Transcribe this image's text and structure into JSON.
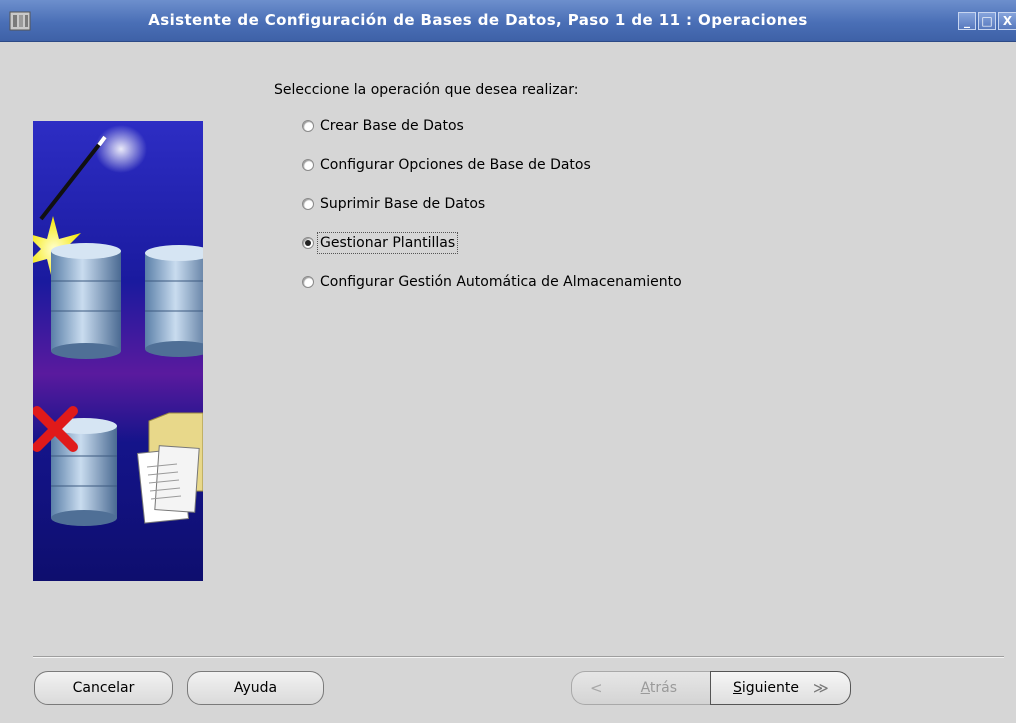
{
  "window": {
    "title": "Asistente de Configuración de Bases de Datos, Paso 1 de 11 : Operaciones",
    "minimize_glyph": "_",
    "maximize_glyph": "□",
    "close_glyph": "X"
  },
  "prompt": "Seleccione la operación que desea realizar:",
  "options": [
    {
      "label": "Crear Base de Datos",
      "checked": false
    },
    {
      "label": "Configurar Opciones de Base de Datos",
      "checked": false
    },
    {
      "label": "Suprimir Base de Datos",
      "checked": false
    },
    {
      "label": "Gestionar Plantillas",
      "checked": true
    },
    {
      "label": "Configurar Gestión Automática de Almacenamiento",
      "checked": false
    }
  ],
  "buttons": {
    "cancel": "Cancelar",
    "help": "Ayuda",
    "back": "Atrás",
    "back_arrow": "<",
    "next": "Siguiente",
    "next_arrow": "≫"
  },
  "icons": {
    "app": "database-app-icon",
    "illustration": "database-wizard-illustration"
  },
  "colors": {
    "titlebar": "#4a6fb6",
    "background": "#d6d6d6",
    "illustration_bg": "#1a1a8c"
  }
}
